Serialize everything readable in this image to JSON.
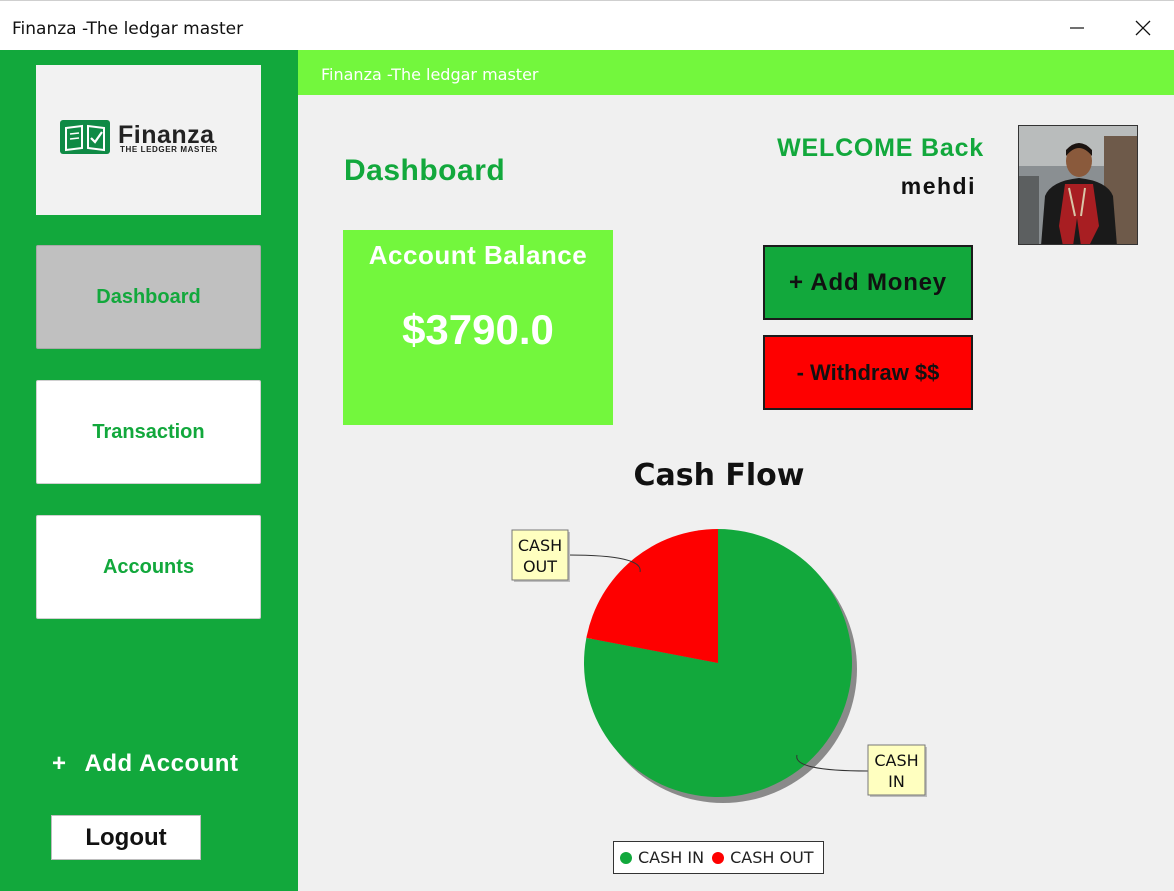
{
  "window": {
    "title": "Finanza -The ledgar master"
  },
  "header": {
    "title": "Finanza -The ledgar master"
  },
  "logo": {
    "name": "Finanza",
    "tagline": "THE LEDGER MASTER"
  },
  "sidebar": {
    "items": [
      {
        "label": "Dashboard",
        "active": true
      },
      {
        "label": "Transaction",
        "active": false
      },
      {
        "label": "Accounts",
        "active": false
      }
    ],
    "add_account_icon": "+",
    "add_account_label": "Add Account",
    "logout_label": "Logout"
  },
  "main": {
    "page_title": "Dashboard",
    "welcome_text": "WELCOME Back",
    "username": "mehdi",
    "avatar_icon": "user-photo-avatar",
    "balance": {
      "label": "Account Balance",
      "value": "$3790.0"
    },
    "buttons": {
      "add_money": "+ Add Money",
      "withdraw": "- Withdraw $$"
    }
  },
  "chart_data": {
    "type": "pie",
    "title": "Cash Flow",
    "slices": [
      {
        "label": "CASH IN",
        "label_lines": [
          "CASH",
          "IN"
        ],
        "value": 78,
        "color": "#12a83c"
      },
      {
        "label": "CASH OUT",
        "label_lines": [
          "CASH",
          "OUT"
        ],
        "value": 22,
        "color": "#fe0000"
      }
    ],
    "legend_position": "bottom"
  },
  "colors": {
    "sidebar": "#12a83c",
    "accent_light": "#73f73d",
    "danger": "#fe0000",
    "active_nav": "#c0c0c0"
  }
}
